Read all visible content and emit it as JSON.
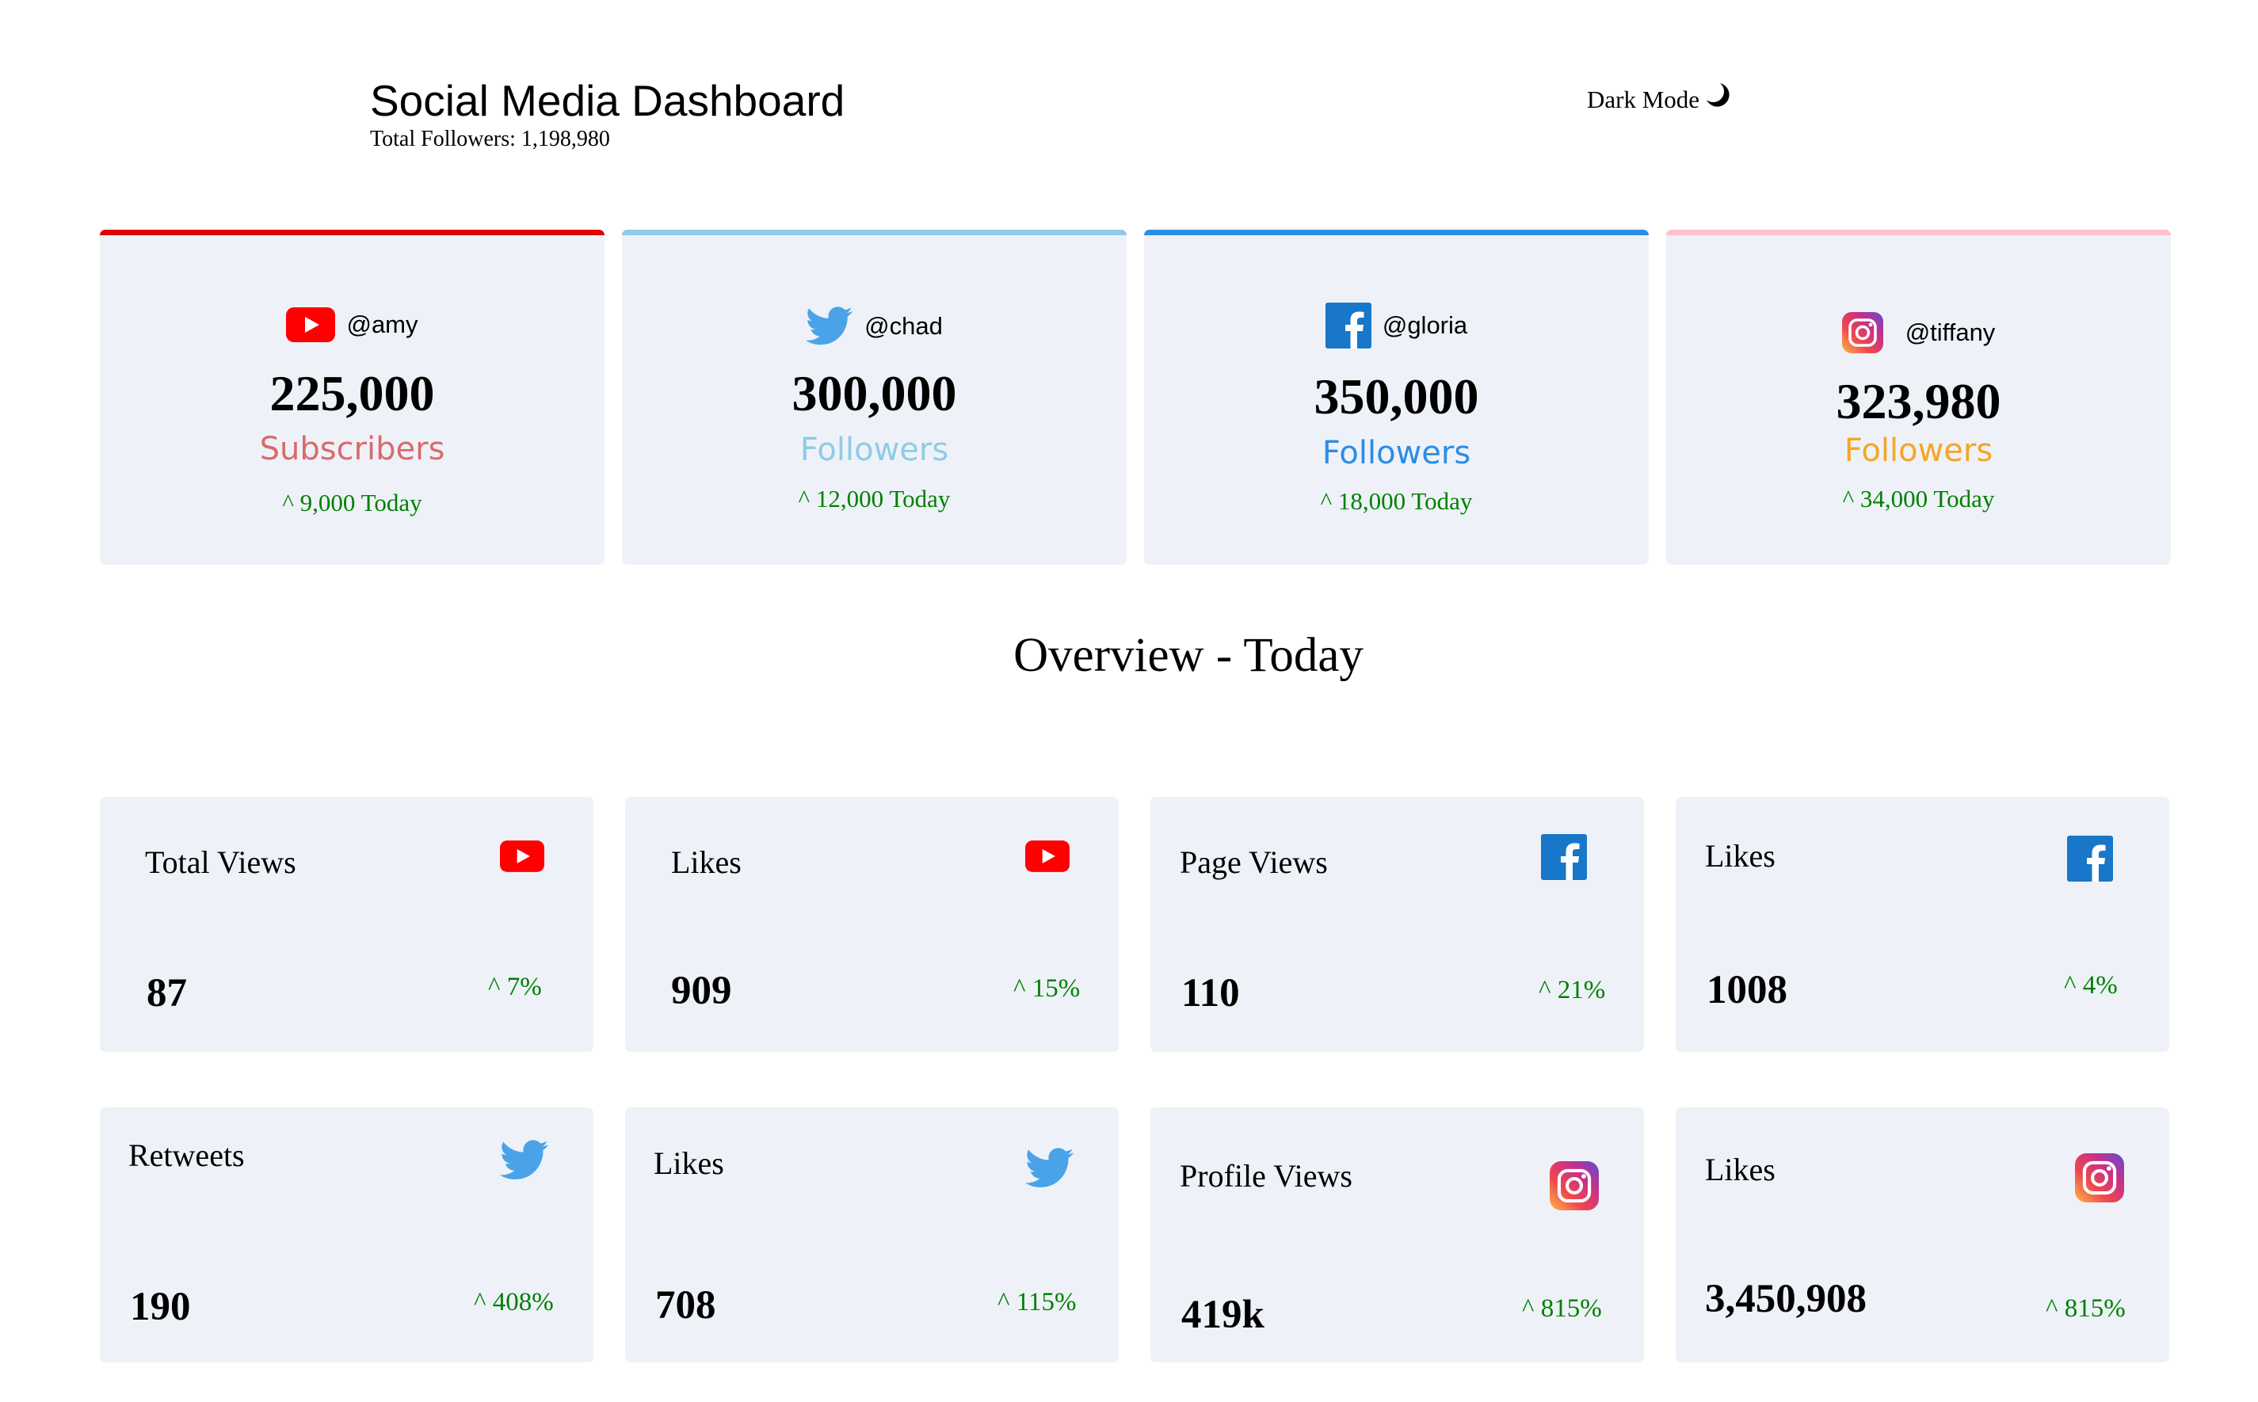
{
  "header": {
    "title": "Social Media Dashboard",
    "total_followers": "Total Followers: 1,198,980",
    "dark_mode_label": "Dark Mode"
  },
  "colors": {
    "youtube": "#e00000",
    "twitter": "#8fcbe6",
    "facebook": "#2a8de6",
    "instagram": "#ffc0cb",
    "positive": "#008000",
    "card_bg": "#eef2f8"
  },
  "follower_cards": [
    {
      "platform": "youtube",
      "icon": "youtube-icon",
      "handle": "@amy",
      "count": "225,000",
      "unit": "Subscribers",
      "unit_color": "#d96b6b",
      "today": "^ 9,000 Today"
    },
    {
      "platform": "twitter",
      "icon": "twitter-icon",
      "handle": "@chad",
      "count": "300,000",
      "unit": "Followers",
      "unit_color": "#8fcbe6",
      "today": "^ 12,000 Today"
    },
    {
      "platform": "facebook",
      "icon": "facebook-icon",
      "handle": "@gloria",
      "count": "350,000",
      "unit": "Followers",
      "unit_color": "#2a8de6",
      "today": "^ 18,000 Today"
    },
    {
      "platform": "instagram",
      "icon": "instagram-icon",
      "handle": "@tiffany",
      "count": "323,980",
      "unit": "Followers",
      "unit_color": "#f5a623",
      "today": "^ 34,000 Today"
    }
  ],
  "overview": {
    "title": "Overview - Today",
    "cards": [
      {
        "label": "Total Views",
        "value": "87",
        "change": "^ 7%",
        "icon": "youtube-icon"
      },
      {
        "label": "Likes",
        "value": "909",
        "change": "^ 15%",
        "icon": "youtube-icon"
      },
      {
        "label": "Page Views",
        "value": "110",
        "change": "^ 21%",
        "icon": "facebook-icon"
      },
      {
        "label": "Likes",
        "value": "1008",
        "change": "^ 4%",
        "icon": "facebook-icon"
      },
      {
        "label": "Retweets",
        "value": "190",
        "change": "^ 408%",
        "icon": "twitter-icon"
      },
      {
        "label": "Likes",
        "value": "708",
        "change": "^ 115%",
        "icon": "twitter-icon"
      },
      {
        "label": "Profile Views",
        "value": "419k",
        "change": "^ 815%",
        "icon": "instagram-icon"
      },
      {
        "label": "Likes",
        "value": "3,450,908",
        "change": "^ 815%",
        "icon": "instagram-icon"
      }
    ]
  }
}
